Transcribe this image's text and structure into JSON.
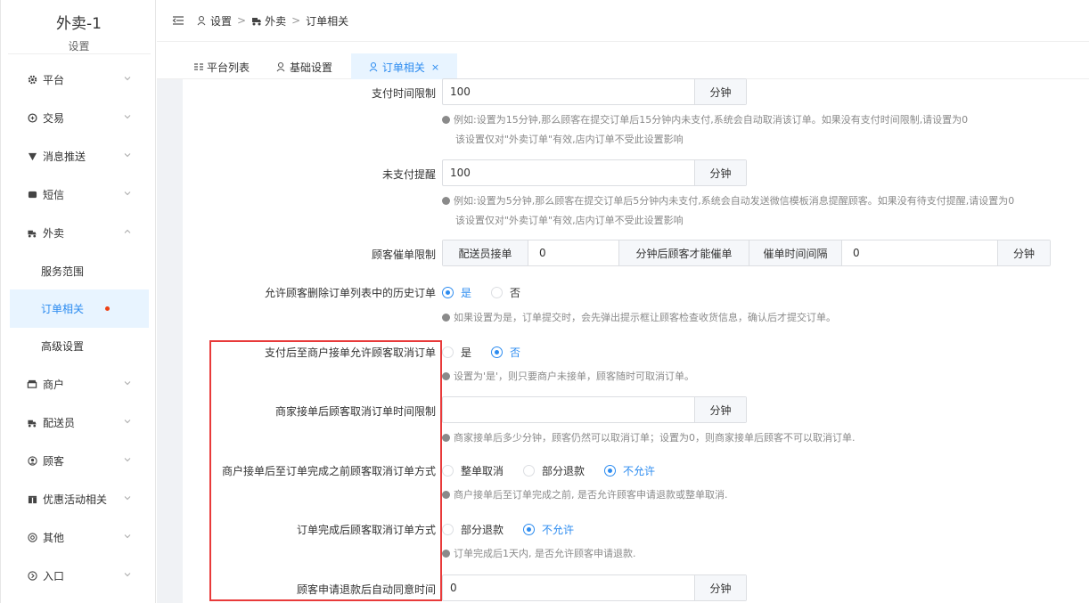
{
  "app": {
    "title": "外卖-1",
    "subtitle": "设置"
  },
  "sidebar": {
    "items": [
      {
        "label": "平台",
        "icon": "gear-icon"
      },
      {
        "label": "交易",
        "icon": "trade-icon"
      },
      {
        "label": "消息推送",
        "icon": "message-icon"
      },
      {
        "label": "短信",
        "icon": "sms-icon"
      },
      {
        "label": "外卖",
        "icon": "delivery-icon",
        "expanded": true
      },
      {
        "label": "商户",
        "icon": "shop-icon"
      },
      {
        "label": "配送员",
        "icon": "courier-icon"
      },
      {
        "label": "顾客",
        "icon": "customer-icon"
      },
      {
        "label": "优惠活动相关",
        "icon": "gift-icon"
      },
      {
        "label": "其他",
        "icon": "other-icon"
      },
      {
        "label": "入口",
        "icon": "entry-icon"
      }
    ],
    "sub_items": [
      {
        "label": "服务范围"
      },
      {
        "label": "订单相关",
        "active": true
      },
      {
        "label": "高级设置"
      }
    ]
  },
  "breadcrumb": {
    "items": [
      "设置",
      "外卖",
      "订单相关"
    ],
    "separator": ">"
  },
  "tabs": [
    {
      "label": "平台列表",
      "icon": "grid-icon"
    },
    {
      "label": "基础设置",
      "icon": "user-icon"
    },
    {
      "label": "订单相关",
      "icon": "user-icon",
      "active": true,
      "close": "×"
    }
  ],
  "form": {
    "pay_time_limit": {
      "label": "支付时间限制",
      "value": "100",
      "unit": "分钟",
      "help1": "例如:设置为15分钟,那么顾客在提交订单后15分钟内未支付,系统会自动取消该订单。如果没有支付时间限制,请设置为0",
      "help2": "该设置仅对\"外卖订单\"有效,店内订单不受此设置影响"
    },
    "unpaid_remind": {
      "label": "未支付提醒",
      "value": "100",
      "unit": "分钟",
      "help1": "例如:设置为5分钟,那么顾客在提交订单后5分钟内未支付,系统会自动发送微信模板消息提醒顾客。如果没有待支付提醒,请设置为0",
      "help2": "该设置仅对\"外卖订单\"有效,店内订单不受此设置影响"
    },
    "reminder_limit": {
      "label": "顾客催单限制",
      "seg1": "配送员接单",
      "val1": "0",
      "seg2": "分钟后顾客才能催单",
      "seg3": "催单时间间隔",
      "val2": "0",
      "seg4": "分钟"
    },
    "delete_history": {
      "label": "允许顾客删除订单列表中的历史订单",
      "options": [
        "是",
        "否"
      ],
      "selected": 0,
      "help": "如果设置为是，订单提交时，会先弹出提示框让顾客检查收货信息，确认后才提交订单。"
    },
    "cancel_after_pay": {
      "label": "支付后至商户接单允许顾客取消订单",
      "options": [
        "是",
        "否"
      ],
      "selected": 1,
      "help": "设置为'是'，则只要商户未接单，顾客随时可取消订单。"
    },
    "cancel_time_limit": {
      "label": "商家接单后顾客取消订单时间限制",
      "value": "",
      "unit": "分钟",
      "help": "商家接单后多少分钟，顾客仍然可以取消订单；设置为0，则商家接单后顾客不可以取消订单."
    },
    "cancel_before_complete": {
      "label": "商户接单后至订单完成之前顾客取消订单方式",
      "options": [
        "整单取消",
        "部分退款",
        "不允许"
      ],
      "selected": 2,
      "help": "商户接单后至订单完成之前, 是否允许顾客申请退款或整单取消."
    },
    "cancel_after_complete": {
      "label": "订单完成后顾客取消订单方式",
      "options": [
        "部分退款",
        "不允许"
      ],
      "selected": 1,
      "help": "订单完成后1天内, 是否允许顾客申请退款."
    },
    "auto_agree": {
      "label": "顾客申请退款后自动同意时间",
      "value": "0",
      "unit": "分钟"
    }
  },
  "colors": {
    "accent": "#2d8cf0",
    "highlight": "#e83a3a",
    "active_bg": "#e8f4ff"
  }
}
